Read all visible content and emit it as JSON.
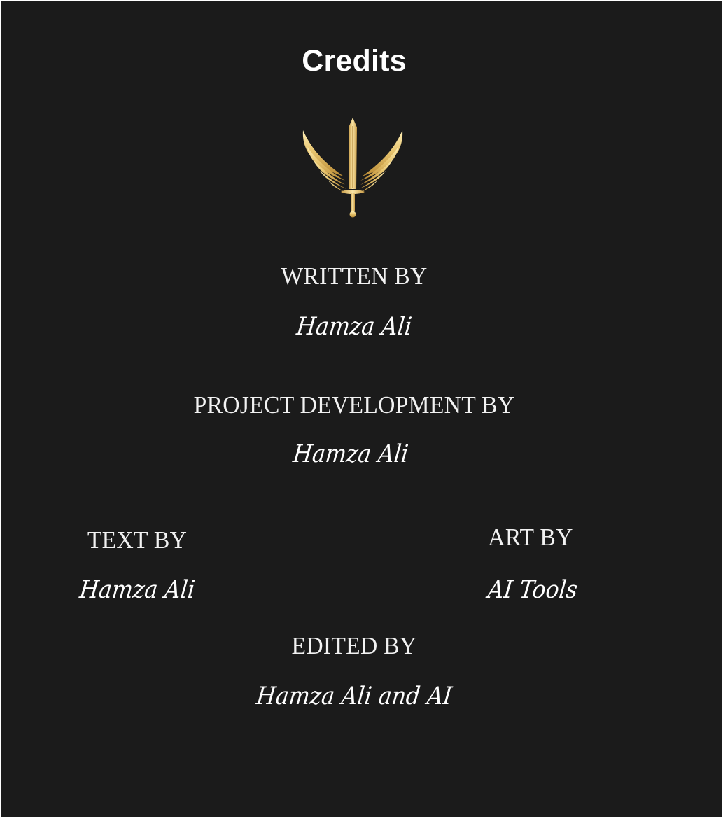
{
  "title": "Credits",
  "emblem": {
    "icon": "winged-sword-icon",
    "color": "#e3c06e"
  },
  "credits": {
    "written": {
      "role": "WRITTEN BY",
      "name": "Hamza Ali"
    },
    "development": {
      "role": "PROJECT DEVELOPMENT BY",
      "name": "Hamza Ali"
    },
    "text": {
      "role": "TEXT BY",
      "name": "Hamza Ali"
    },
    "art": {
      "role": "ART BY",
      "name": "AI Tools"
    },
    "edited": {
      "role": "EDITED BY",
      "name": "Hamza Ali and AI"
    }
  }
}
